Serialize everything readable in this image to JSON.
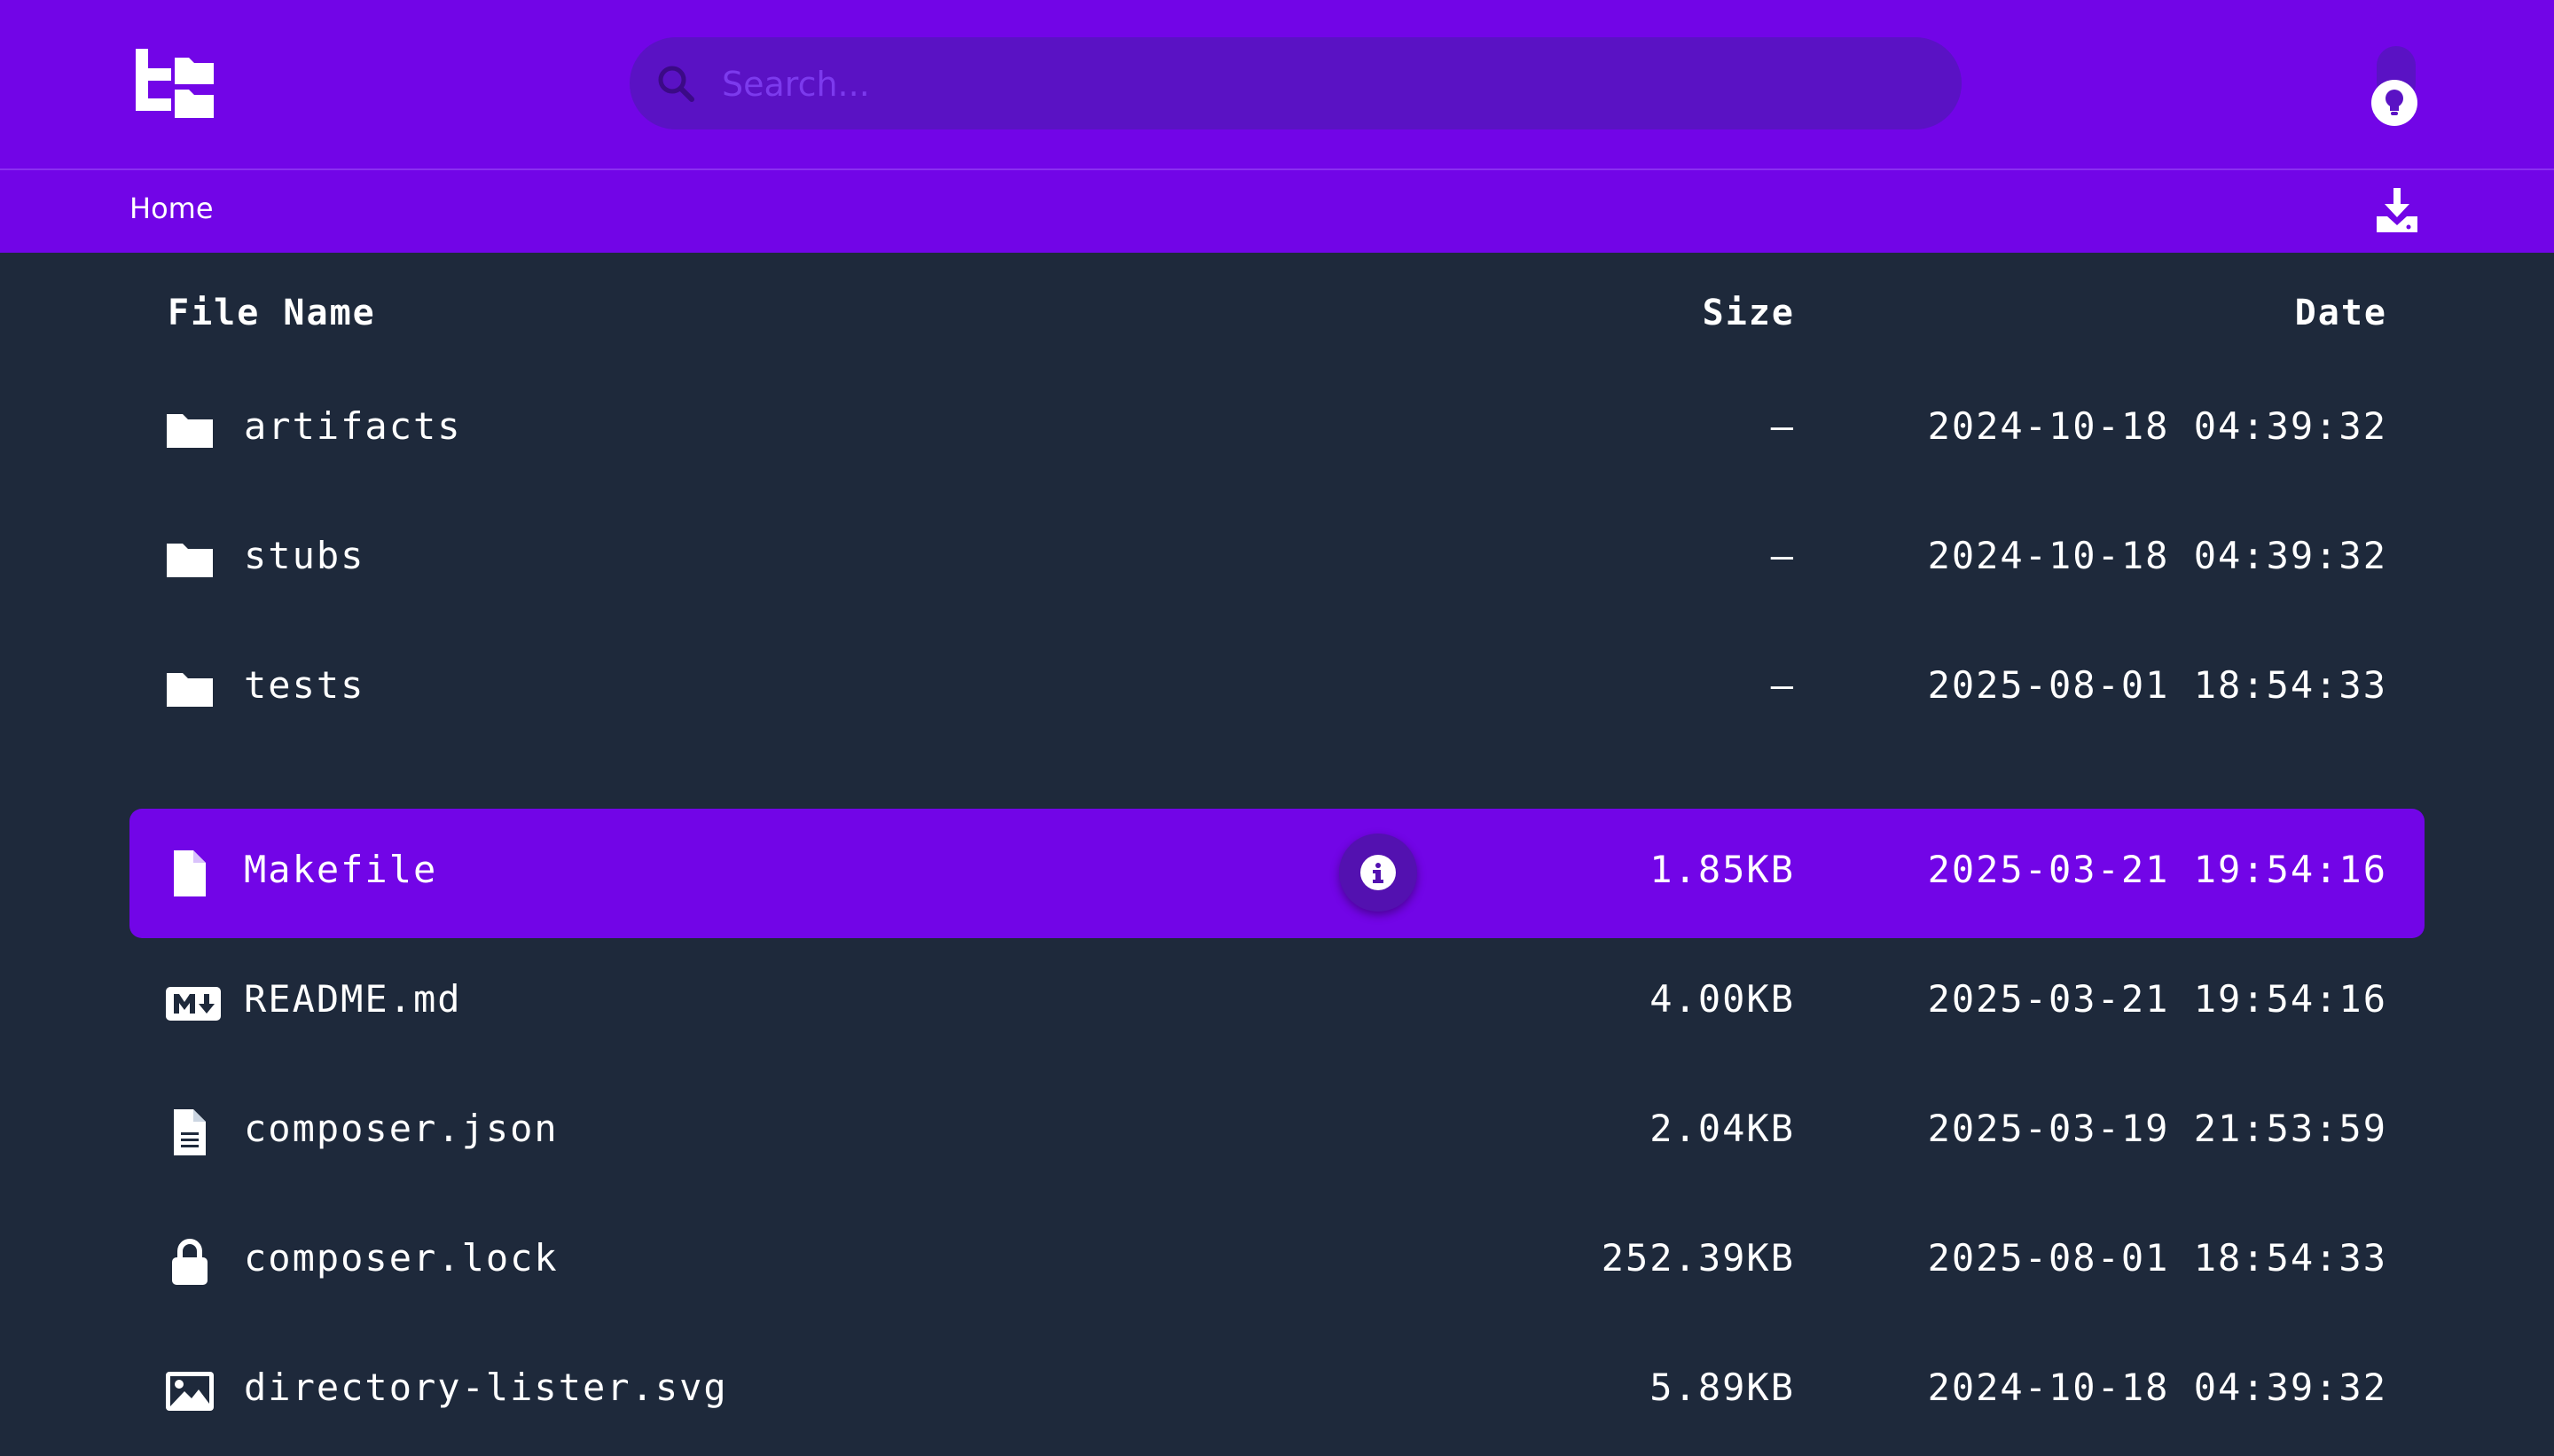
{
  "colors": {
    "brand": "#7205e7",
    "background": "#1e293b",
    "search_bg": "#5a12c4",
    "text": "#ffffff"
  },
  "header": {
    "logo_icon": "directory-lister-logo",
    "search": {
      "placeholder": "Search...",
      "value": ""
    },
    "theme_toggle_icon": "lightbulb-icon"
  },
  "breadcrumb": {
    "items": [
      "Home"
    ],
    "download_icon": "download-icon"
  },
  "table": {
    "columns": {
      "name": "File Name",
      "size": "Size",
      "date": "Date"
    },
    "rows": [
      {
        "icon": "folder-icon",
        "name": "artifacts",
        "size": "—",
        "date": "2024-10-18 04:39:32",
        "selected": false
      },
      {
        "icon": "folder-icon",
        "name": "stubs",
        "size": "—",
        "date": "2024-10-18 04:39:32",
        "selected": false
      },
      {
        "icon": "folder-icon",
        "name": "tests",
        "size": "—",
        "date": "2025-08-01 18:54:33",
        "selected": false
      },
      {
        "icon": "file-icon",
        "name": "Makefile",
        "size": "1.85KB",
        "date": "2025-03-21 19:54:16",
        "selected": true
      },
      {
        "icon": "markdown-icon",
        "name": "README.md",
        "size": "4.00KB",
        "date": "2025-03-21 19:54:16",
        "selected": false
      },
      {
        "icon": "file-text-icon",
        "name": "composer.json",
        "size": "2.04KB",
        "date": "2025-03-19 21:53:59",
        "selected": false
      },
      {
        "icon": "lock-icon",
        "name": "composer.lock",
        "size": "252.39KB",
        "date": "2025-08-01 18:54:33",
        "selected": false
      },
      {
        "icon": "image-icon",
        "name": "directory-lister.svg",
        "size": "5.89KB",
        "date": "2024-10-18 04:39:32",
        "selected": false
      }
    ],
    "info_icon": "info-icon"
  }
}
